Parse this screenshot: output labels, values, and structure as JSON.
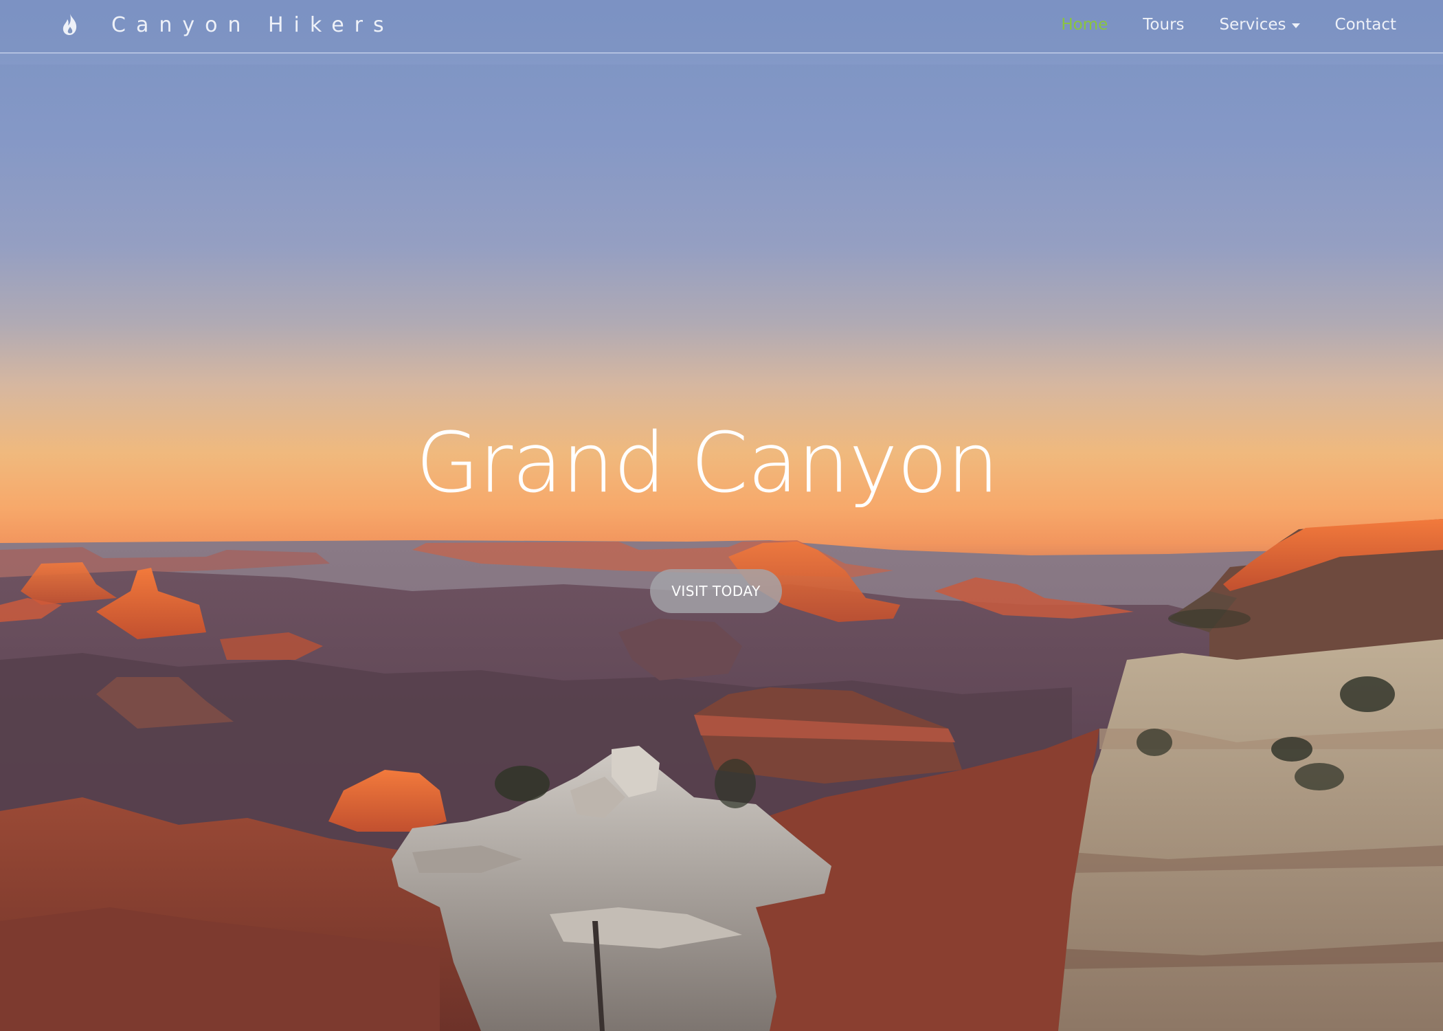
{
  "brand": {
    "icon": "flame-icon",
    "name": "Canyon Hikers"
  },
  "nav": {
    "items": [
      {
        "label": "Home",
        "active": true
      },
      {
        "label": "Tours",
        "active": false
      },
      {
        "label": "Services",
        "active": false,
        "dropdown": true
      },
      {
        "label": "Contact",
        "active": false
      }
    ]
  },
  "hero": {
    "title": "Grand Canyon",
    "cta_label": "VISIT TODAY",
    "background": "canyon-sunset-photo"
  },
  "colors": {
    "active_nav": "#8ac53f",
    "nav_text": "#eef1f8",
    "cta_background": "#a5a5aa"
  }
}
